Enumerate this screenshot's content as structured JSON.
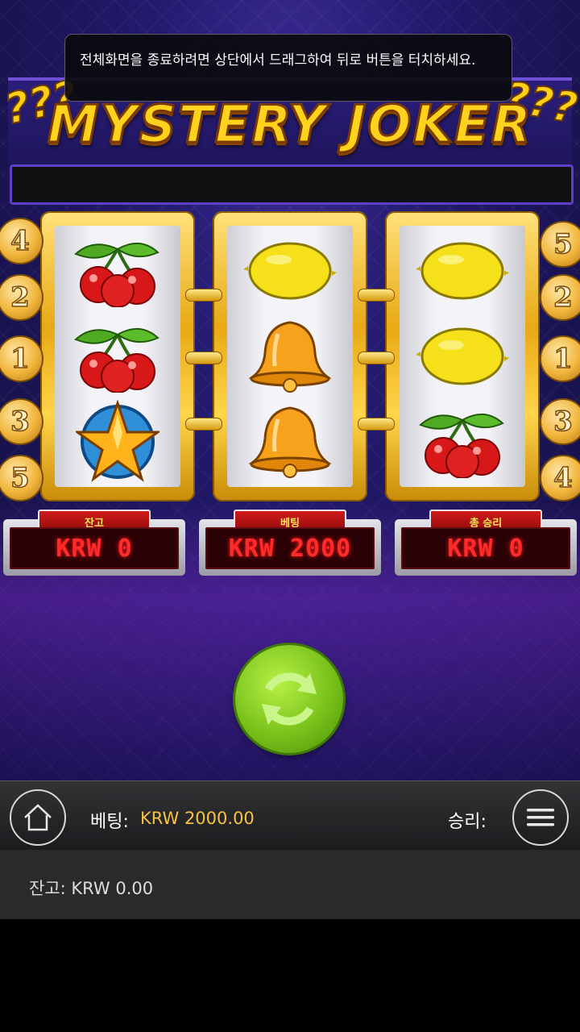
{
  "toast": {
    "message": "전체화면을 종료하려면 상단에서 드래그하여 뒤로 버튼을 터치하세요."
  },
  "game": {
    "title": "MYSTERY JOKER",
    "reels": [
      [
        "cherry",
        "cherry",
        "star"
      ],
      [
        "lemon",
        "bell",
        "bell"
      ],
      [
        "lemon",
        "lemon",
        "cherry"
      ]
    ],
    "paylines_left": [
      "4",
      "2",
      "1",
      "3",
      "5"
    ],
    "paylines_right": [
      "5",
      "2",
      "1",
      "3",
      "4"
    ]
  },
  "panels": {
    "balance": {
      "label": "잔고",
      "value": "KRW 0"
    },
    "bet": {
      "label": "베팅",
      "value": "KRW 2000"
    },
    "total_win": {
      "label": "총 승리",
      "value": "KRW 0"
    }
  },
  "bottom_bar": {
    "bet_label": "베팅:",
    "bet_value": "KRW 2000.00",
    "win_label": "승리:",
    "home_icon": "home-icon",
    "menu_icon": "menu-icon"
  },
  "balance_bar": {
    "text": "잔고: KRW 0.00"
  },
  "colors": {
    "bet_value": "#f6c244",
    "led": "#ff2a2a",
    "spin": "#78c21a"
  }
}
